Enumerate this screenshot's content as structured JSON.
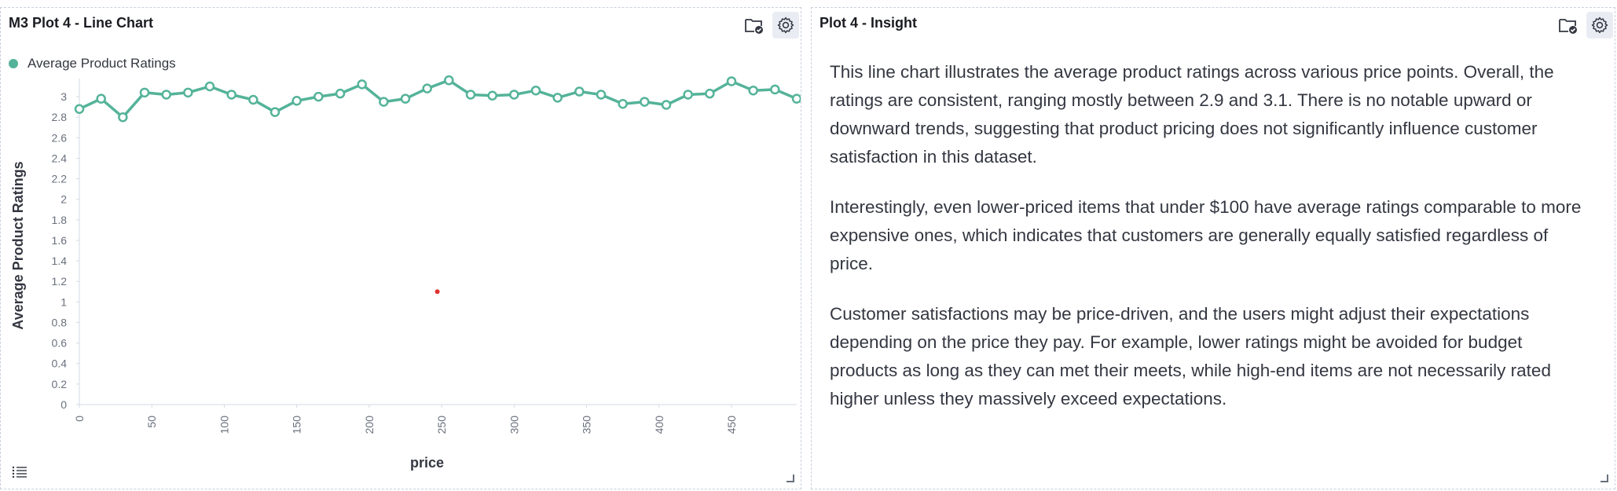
{
  "left_panel": {
    "title": "M3 Plot 4 - Line Chart",
    "legend_label": "Average Product Ratings",
    "icons": [
      "folder-check-icon",
      "gear-icon",
      "list-icon"
    ]
  },
  "right_panel": {
    "title": "Plot 4 - Insight",
    "paragraphs": [
      "This line chart illustrates the average product ratings across various price points. Overall, the ratings are consistent, ranging mostly between 2.9 and 3.1. There is no notable upward or downward trends, suggesting that product pricing does not significantly influence customer satisfaction in this dataset.",
      "Interestingly, even lower-priced items that under $100 have average ratings comparable to more expensive ones, which indicates that customers are generally equally satisfied regardless of price.",
      "Customer satisfactions may be price-driven, and the users might adjust their expectations depending on the price they pay. For example, lower ratings might be avoided for budget products as long as they can met their meets, while high-end items are not necessarily rated higher unless they massively exceed expectations."
    ],
    "icons": [
      "folder-check-icon",
      "gear-icon"
    ]
  },
  "colors": {
    "series": "#54b399",
    "marker": "#e7664c"
  },
  "chart_data": {
    "type": "line",
    "xlabel": "price",
    "ylabel": "Average Product Ratings",
    "xlim": [
      0,
      495
    ],
    "ylim": [
      0,
      3.1
    ],
    "x_ticks": [
      0,
      50,
      100,
      150,
      200,
      250,
      300,
      350,
      400,
      450
    ],
    "y_ticks": [
      0,
      0.2,
      0.4,
      0.6,
      0.8,
      1,
      1.2,
      1.4,
      1.6,
      1.8,
      2,
      2.2,
      2.4,
      2.6,
      2.8,
      3
    ],
    "series": [
      {
        "name": "Average Product Ratings",
        "x": [
          0,
          15,
          30,
          45,
          60,
          75,
          90,
          105,
          120,
          135,
          150,
          165,
          180,
          195,
          210,
          225,
          240,
          255,
          270,
          285,
          300,
          315,
          330,
          345,
          360,
          375,
          390,
          405,
          420,
          435,
          450,
          465,
          480,
          495
        ],
        "y": [
          2.88,
          2.98,
          2.8,
          3.04,
          3.02,
          3.04,
          3.1,
          3.02,
          2.97,
          2.85,
          2.96,
          3.0,
          3.03,
          3.12,
          2.95,
          2.98,
          3.08,
          3.16,
          3.02,
          3.01,
          3.02,
          3.06,
          2.99,
          3.05,
          3.02,
          2.93,
          2.95,
          2.92,
          3.02,
          3.03,
          3.15,
          3.06,
          3.07,
          2.98
        ]
      }
    ],
    "annotation_point": {
      "x": 247,
      "y": 1.1
    }
  }
}
